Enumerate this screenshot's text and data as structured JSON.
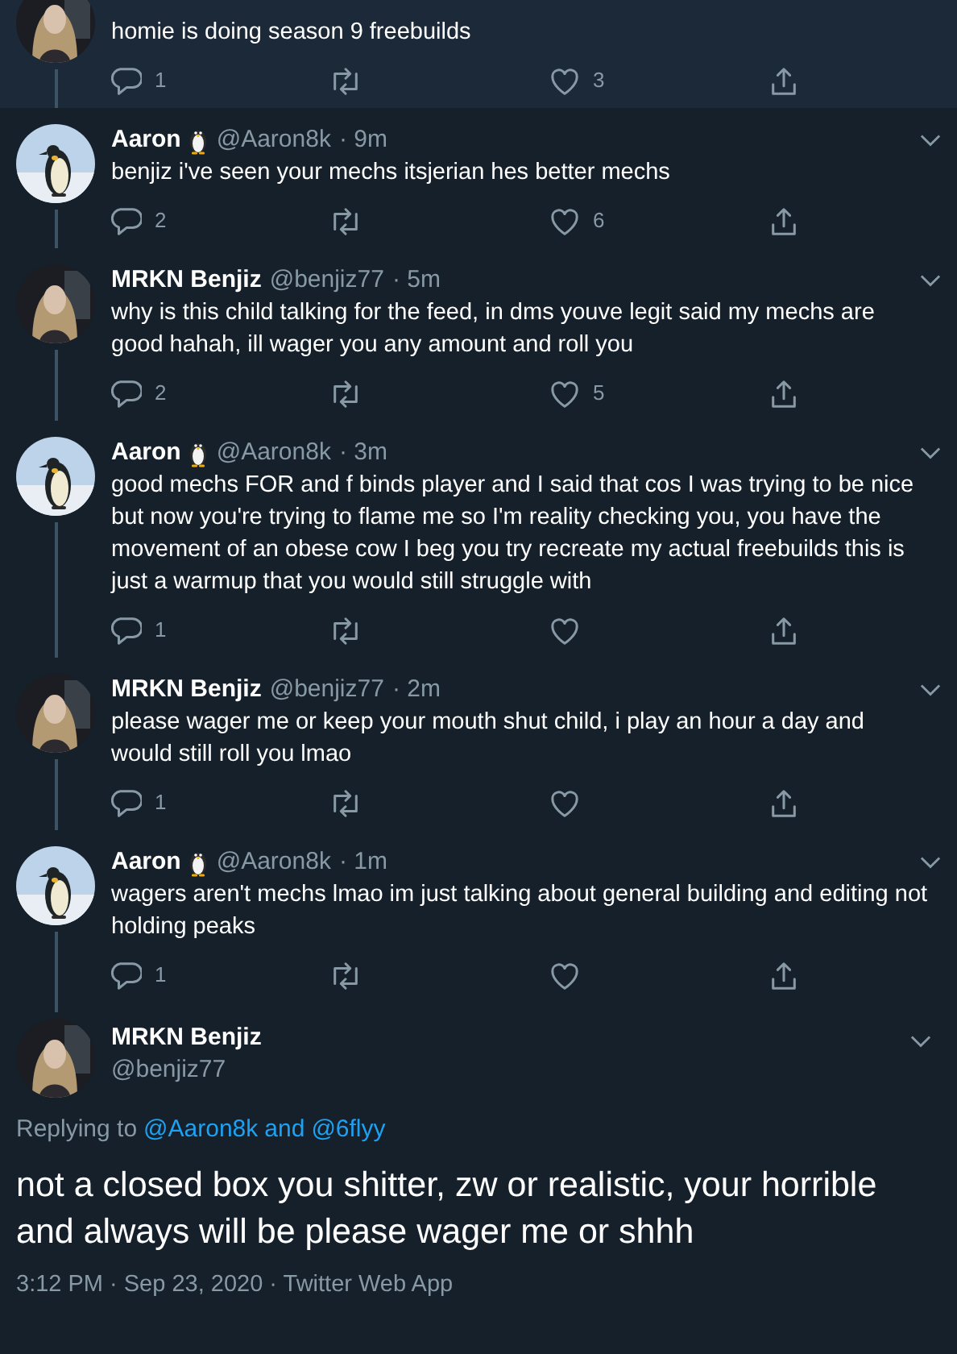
{
  "thread": [
    {
      "highlighted": true,
      "text": "homie is doing season 9 freebuilds",
      "replies": "1",
      "likes": "3"
    },
    {
      "highlighted": false,
      "author": {
        "name": "Aaron",
        "emoji_badge": true,
        "handle": "@Aaron8k",
        "time": "· 9m"
      },
      "text": "benjiz i've seen your mechs itsjerian hes better mechs",
      "replies": "2",
      "likes": "6"
    },
    {
      "highlighted": false,
      "author": {
        "name": "MRKN Benjiz",
        "emoji_badge": false,
        "handle": "@benjiz77",
        "time": "· 5m"
      },
      "text": "why is this child talking for the feed, in dms youve legit said my mechs are good hahah, ill wager you any amount and roll you",
      "replies": "2",
      "likes": "5"
    },
    {
      "highlighted": false,
      "author": {
        "name": "Aaron",
        "emoji_badge": true,
        "handle": "@Aaron8k",
        "time": "· 3m"
      },
      "text": "good mechs FOR and f binds player and I said that cos I was trying to be nice but now you're trying to flame me so I'm reality checking you, you have the movement of an obese cow I beg you try recreate my actual freebuilds this is just a warmup that you would still struggle with",
      "replies": "1"
    },
    {
      "highlighted": false,
      "author": {
        "name": "MRKN Benjiz",
        "emoji_badge": false,
        "handle": "@benjiz77",
        "time": "· 2m"
      },
      "text": "please wager me or keep your mouth shut child, i play an hour a day and would still roll you lmao",
      "replies": "1"
    },
    {
      "highlighted": false,
      "author": {
        "name": "Aaron",
        "emoji_badge": true,
        "handle": "@Aaron8k",
        "time": "· 1m"
      },
      "text": "wagers aren't mechs lmao im just talking about general building and editing not holding peaks",
      "replies": "1"
    }
  ],
  "focused": {
    "name": "MRKN Benjiz",
    "handle": "@benjiz77",
    "replying_label": "Replying to",
    "replying_to": [
      "@Aaron8k",
      "@6flyy"
    ],
    "replying_joiner": "and",
    "text": "not a closed box you shitter, zw or realistic, your horrible and always will be please wager me or shhh",
    "timestamp": "3:12 PM · Sep 23, 2020 · Twitter Web App"
  }
}
